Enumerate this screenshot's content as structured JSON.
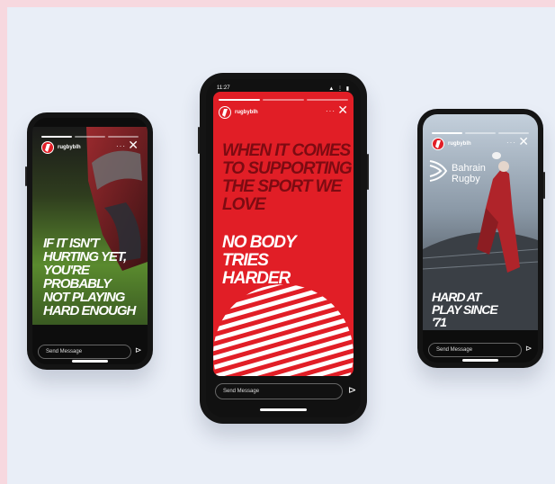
{
  "phones": {
    "left": {
      "handle": "rugbyblh",
      "quote": "IF IT ISN'T HURTING YET, YOU'RE PROBABLY NOT PLAYING HARD ENOUGH",
      "message_placeholder": "Send Message"
    },
    "center": {
      "time": "11:27",
      "signal": "▲ ⋮ ▮",
      "handle": "rugbyblh",
      "quote_top": "WHEN IT COMES TO SUPPORTING THE SPORT WE LOVE",
      "quote_bottom": "NO BODY TRIES HARDER",
      "message_placeholder": "Send Message"
    },
    "right": {
      "handle": "rugbyblh",
      "brand_line1": "Bahrain",
      "brand_line2": "Rugby",
      "quote": "HARD AT PLAY SINCE '71",
      "message_placeholder": "Send Message"
    }
  },
  "icons": {
    "close": "close-icon",
    "more": "more-icon",
    "send": "send-icon"
  },
  "colors": {
    "brand_red": "#e11e26",
    "quote_dark_red": "#7d0b12",
    "phone_body": "#141414",
    "background": "#e9eef7",
    "border": "#f7d8df"
  }
}
